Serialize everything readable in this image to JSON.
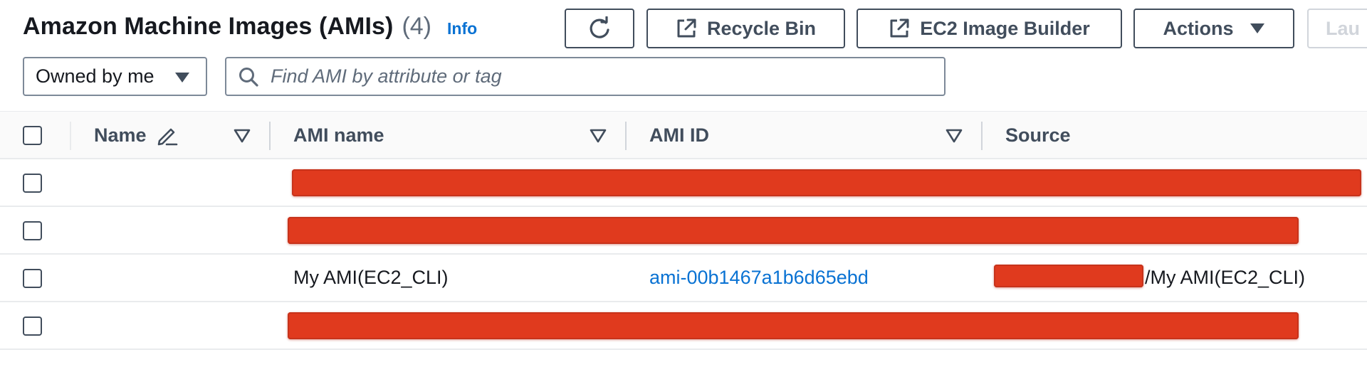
{
  "header": {
    "title": "Amazon Machine Images (AMIs)",
    "count": "(4)",
    "info_label": "Info"
  },
  "toolbar": {
    "recycle_bin_label": "Recycle Bin",
    "image_builder_label": "EC2 Image Builder",
    "actions_label": "Actions",
    "launch_label": "Lau"
  },
  "filter": {
    "owner_selected": "Owned by me",
    "search_placeholder": "Find AMI by attribute or tag"
  },
  "table": {
    "columns": {
      "name": "Name",
      "ami_name": "AMI name",
      "ami_id": "AMI ID",
      "source": "Source"
    },
    "rows": [
      {
        "name": "",
        "ami_name": "",
        "ami_id": "",
        "source": "",
        "redacted": true
      },
      {
        "name": "",
        "ami_name": "",
        "ami_id": "",
        "source": "",
        "redacted": true
      },
      {
        "name": "",
        "ami_name": "My AMI(EC2_CLI)",
        "ami_id": "ami-00b1467a1b6d65ebd",
        "source": "/My AMI(EC2_CLI)",
        "redacted": false
      },
      {
        "name": "",
        "ami_name": "",
        "ami_id": "",
        "source": "",
        "redacted": true
      }
    ]
  },
  "icons": {
    "refresh": "refresh-icon",
    "external_link": "external-link-icon",
    "caret_down": "caret-down-icon",
    "search": "search-icon",
    "edit": "pencil-icon",
    "sort": "sort-down-icon"
  },
  "colors": {
    "link": "#0972d3",
    "text": "#16191f",
    "button_border": "#414d5c",
    "redaction": "#e03a1e"
  }
}
